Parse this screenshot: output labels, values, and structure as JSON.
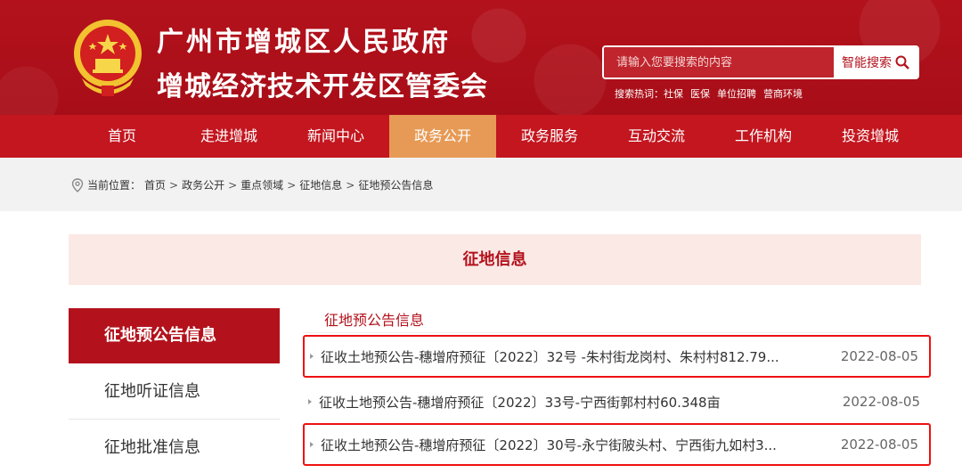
{
  "header": {
    "title_line1": "广州市增城区人民政府",
    "title_line2": "增城经济技术开发区管委会",
    "search": {
      "placeholder": "请输入您要搜索的内容",
      "button_label": "智能搜索"
    },
    "hot_search": {
      "label": "搜索热词：",
      "terms": [
        "社保",
        "医保",
        "单位招聘",
        "营商环境"
      ]
    }
  },
  "nav": {
    "items": [
      "首页",
      "走进增城",
      "新闻中心",
      "政务公开",
      "政务服务",
      "互动交流",
      "工作机构",
      "投资增城"
    ],
    "active_index": 3
  },
  "breadcrumb": {
    "label": "当前位置：",
    "items": [
      "首页",
      "政务公开",
      "重点领域",
      "征地信息",
      "征地预公告信息"
    ]
  },
  "section_title": "征地信息",
  "sidebar": {
    "items": [
      "征地预公告信息",
      "征地听证信息",
      "征地批准信息"
    ],
    "active_index": 0
  },
  "list": {
    "title": "征地预公告信息",
    "rows": [
      {
        "title": "征收土地预公告-穗增府预征〔2022〕32号 -朱村街龙岗村、朱村村812.79...",
        "date": "2022-08-05",
        "highlighted": true
      },
      {
        "title": "征收土地预公告-穗增府预征〔2022〕33号-宁西街郭村村60.348亩",
        "date": "2022-08-05",
        "highlighted": false
      },
      {
        "title": "征收土地预公告-穗增府预征〔2022〕30号-永宁街陂头村、宁西街九如村3...",
        "date": "2022-08-05",
        "highlighted": true
      }
    ]
  },
  "colors": {
    "brand_red": "#b3121c",
    "nav_red": "#c3161f",
    "nav_active": "#e79a55",
    "highlight_border": "#ee1111"
  }
}
